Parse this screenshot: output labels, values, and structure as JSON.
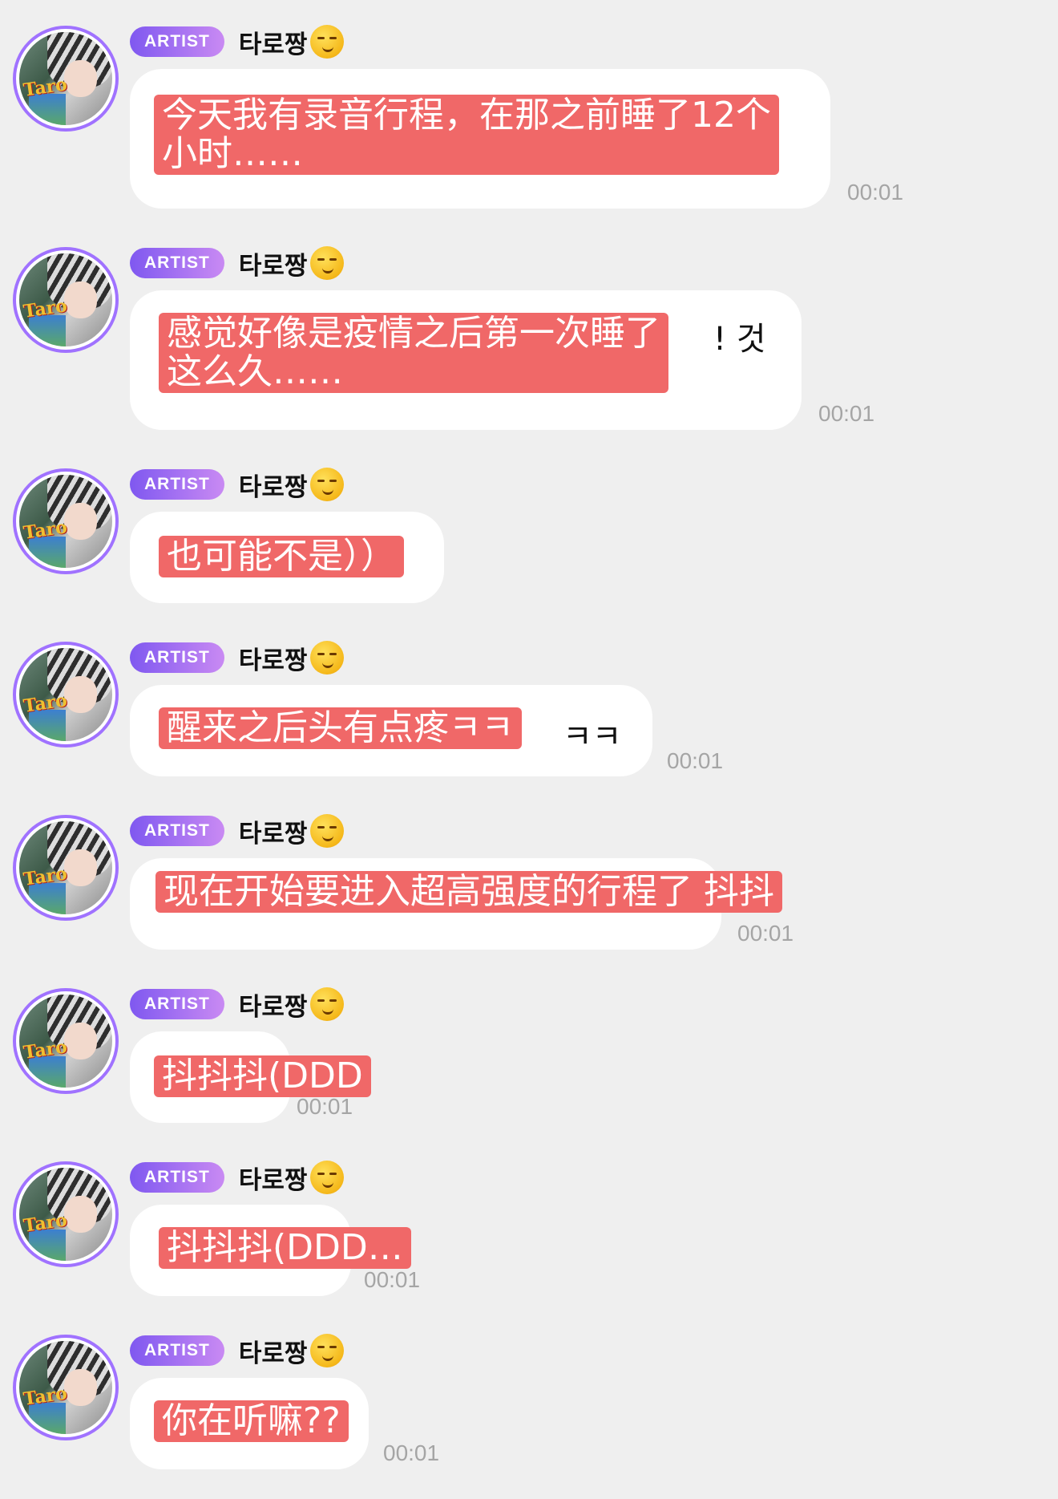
{
  "messages": [
    {
      "badge": "ARTIST",
      "name": "타로짱",
      "emoji_icon": "smirking-face-emoji",
      "text_line1": "今天我有录音行程，在那之前睡了12个",
      "text_line2": "小时……",
      "tail": "",
      "time": "00:01"
    },
    {
      "badge": "ARTIST",
      "name": "타로짱",
      "emoji_icon": "smirking-face-emoji",
      "text_line1": "感觉好像是疫情之后第一次睡了",
      "text_line2": "这么久……",
      "tail": "! 것",
      "time": "00:01"
    },
    {
      "badge": "ARTIST",
      "name": "타로짱",
      "emoji_icon": "smirking-face-emoji",
      "text_line1": "也可能不是））",
      "text_line2": "",
      "tail": "",
      "time": ""
    },
    {
      "badge": "ARTIST",
      "name": "타로짱",
      "emoji_icon": "smirking-face-emoji",
      "text_line1": "醒来之后头有点疼ㅋㅋ",
      "text_line2": "",
      "tail": "ㅋㅋ",
      "time": "00:01"
    },
    {
      "badge": "ARTIST",
      "name": "타로짱",
      "emoji_icon": "smirking-face-emoji",
      "text_line1": "现在开始要进入超高强度的行程了 抖抖",
      "text_line2": "",
      "tail": "",
      "time": "00:01"
    },
    {
      "badge": "ARTIST",
      "name": "타로짱",
      "emoji_icon": "smirking-face-emoji",
      "text_line1": "抖抖抖(DDD",
      "text_line2": "",
      "tail": "",
      "time": "00:01"
    },
    {
      "badge": "ARTIST",
      "name": "타로짱",
      "emoji_icon": "smirking-face-emoji",
      "text_line1": "抖抖抖(DDD…",
      "text_line2": "",
      "tail": "",
      "time": "00:01"
    },
    {
      "badge": "ARTIST",
      "name": "타로짱",
      "emoji_icon": "smirking-face-emoji",
      "text_line1": "你在听嘛??",
      "text_line2": "",
      "tail": "",
      "time": "00:01"
    }
  ],
  "colors": {
    "background": "#efefef",
    "badge_start": "#7f58f0",
    "badge_end": "#c98af3",
    "translation_overlay": "#f06868",
    "timestamp": "#a5a5a5",
    "avatar_ring": "#a072ff"
  }
}
